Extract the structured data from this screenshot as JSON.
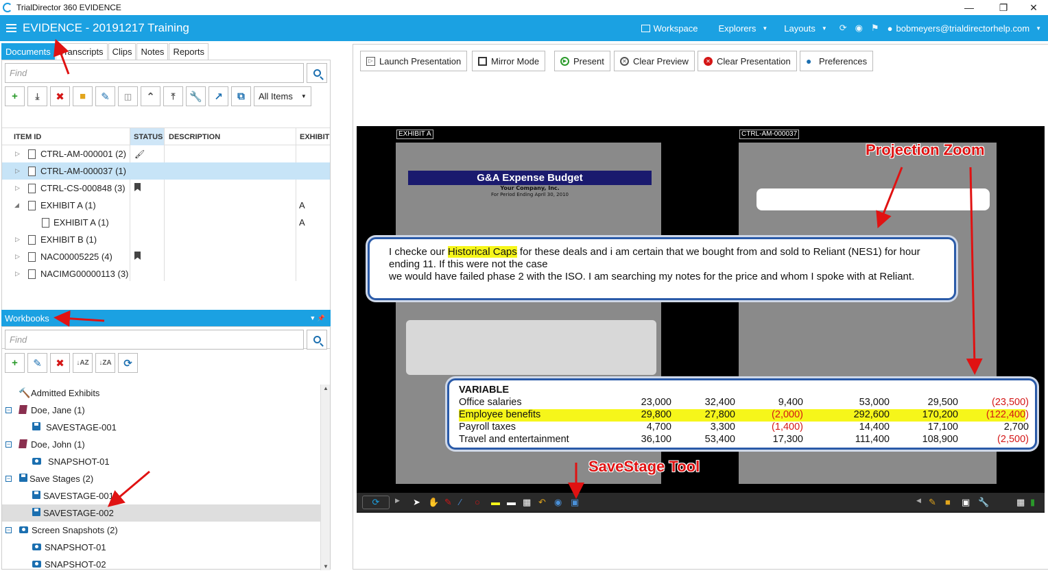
{
  "window": {
    "title": "TrialDirector 360 EVIDENCE"
  },
  "appbar": {
    "case_title": "EVIDENCE - 20191217 Training",
    "workspace": "Workspace",
    "explorers": "Explorers",
    "layouts": "Layouts",
    "user": "bobmeyers@trialdirectorhelp.com"
  },
  "left_tabs": [
    "Documents",
    "Transcripts",
    "Clips",
    "Notes",
    "Reports"
  ],
  "documents": {
    "find_placeholder": "Find",
    "filter": "All Items",
    "columns": {
      "item_id": "ITEM ID",
      "status": "STATUS",
      "description": "DESCRIPTION",
      "exhibit": "EXHIBIT N"
    },
    "rows": [
      {
        "id": "CTRL-AM-000001 (2)",
        "status": "brush",
        "exhibit": ""
      },
      {
        "id": "CTRL-AM-000037 (1)",
        "status": "",
        "exhibit": ""
      },
      {
        "id": "CTRL-CS-000848 (3)",
        "status": "bookmark",
        "exhibit": ""
      },
      {
        "id": "EXHIBIT A (1)",
        "status": "",
        "exhibit": "A"
      },
      {
        "id": "EXHIBIT A (1)",
        "status": "",
        "exhibit": "A"
      },
      {
        "id": "EXHIBIT B (1)",
        "status": "",
        "exhibit": ""
      },
      {
        "id": "NAC00005225 (4)",
        "status": "bookmark",
        "exhibit": ""
      },
      {
        "id": "NACIMG00000113 (3)",
        "status": "",
        "exhibit": ""
      }
    ]
  },
  "workbooks": {
    "title": "Workbooks",
    "find_placeholder": "Find",
    "items": [
      {
        "label": "Admitted Exhibits"
      },
      {
        "label": "Doe, Jane  (1)"
      },
      {
        "label": "SAVESTAGE-001"
      },
      {
        "label": "Doe, John  (1)"
      },
      {
        "label": "SNAPSHOT-01"
      },
      {
        "label": "Save Stages (2)"
      },
      {
        "label": "SAVESTAGE-001"
      },
      {
        "label": "SAVESTAGE-002"
      },
      {
        "label": "Screen Snapshots (2)"
      },
      {
        "label": "SNAPSHOT-01"
      },
      {
        "label": "SNAPSHOT-02"
      }
    ]
  },
  "presentation_toolbar": {
    "launch": "Launch Presentation",
    "mirror": "Mirror Mode",
    "present": "Present",
    "clear_preview": "Clear Preview",
    "clear_presentation": "Clear Presentation",
    "preferences": "Preferences"
  },
  "stage": {
    "left_tag": "EXHIBIT A",
    "right_tag": "CTRL-AM-000037",
    "budget_title": "G&A Expense Budget",
    "budget_company": "Your Company, Inc.",
    "budget_period": "For Period Ending April 30, 2010",
    "zoom1_pre": "I checke our ",
    "zoom1_hl": "Historical Caps",
    "zoom1_post": " for these deals and i am certain that we bought from and sold to Reliant (NES1) for hour ending 11.  If this were not the case",
    "zoom1_line2": "we would have failed phase 2 with the ISO.  I am searching my notes for the price and whom I spoke with at Reliant.",
    "variable_header": "VARIABLE",
    "variable_rows": [
      {
        "label": "Office salaries",
        "v": [
          "23,000",
          "32,400",
          "9,400",
          "53,000",
          "29,500",
          "(23,500)"
        ],
        "highlight": false
      },
      {
        "label": "Employee benefits",
        "v": [
          "29,800",
          "27,800",
          "(2,000)",
          "292,600",
          "170,200",
          "(122,400)"
        ],
        "highlight": true
      },
      {
        "label": "Payroll taxes",
        "v": [
          "4,700",
          "3,300",
          "(1,400)",
          "14,400",
          "17,100",
          "2,700"
        ],
        "highlight": false
      },
      {
        "label": "Travel and entertainment",
        "v": [
          "36,100",
          "53,400",
          "17,300",
          "111,400",
          "108,900",
          "(2,500)"
        ],
        "highlight": false
      }
    ]
  },
  "annotations": {
    "projection_zoom": "Projection Zoom",
    "savestage_tool": "SaveStage Tool"
  },
  "colors": {
    "accent": "#1ba1e2",
    "annotation": "#e01212",
    "highlight": "#f6f61a"
  }
}
